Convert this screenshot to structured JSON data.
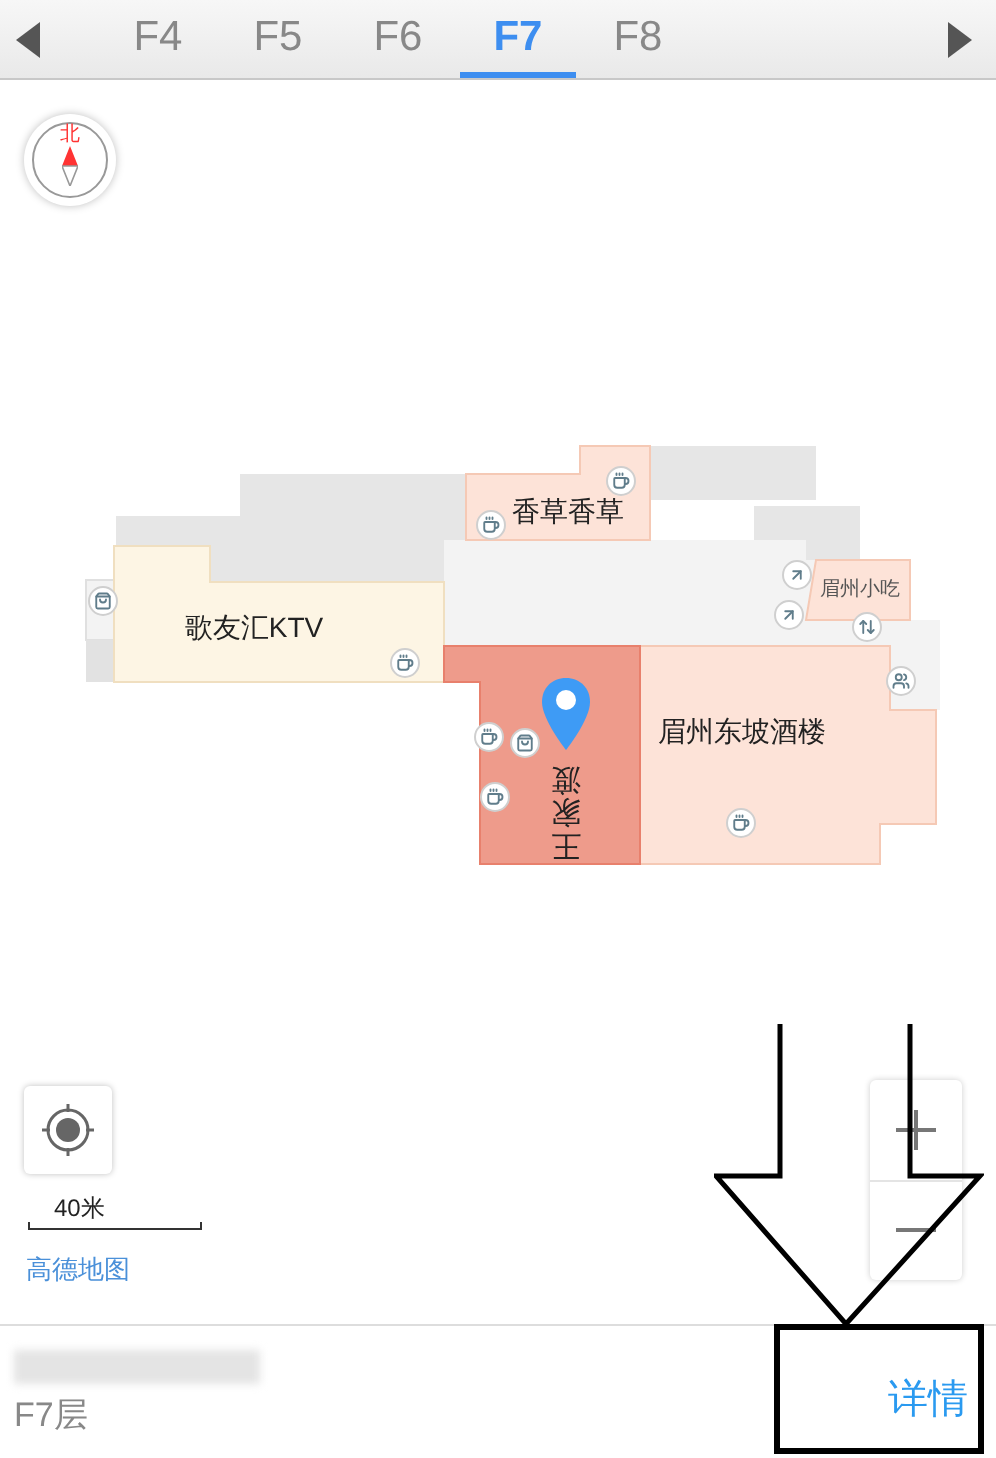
{
  "tabs": [
    {
      "label": "F4",
      "selected": false
    },
    {
      "label": "F5",
      "selected": false
    },
    {
      "label": "F6",
      "selected": false
    },
    {
      "label": "F7",
      "selected": true
    },
    {
      "label": "F8",
      "selected": false
    }
  ],
  "map": {
    "compass_label": "北",
    "shops": [
      {
        "kind": "label",
        "name": "香草香草",
        "selected": false
      },
      {
        "kind": "label",
        "name": "歌友汇KTV",
        "selected": false
      },
      {
        "kind": "small-label",
        "name": "眉州小吃",
        "selected": false
      },
      {
        "kind": "label",
        "name": "眉州东坡酒楼",
        "selected": false
      },
      {
        "kind": "vertical-label",
        "name": "王家渡",
        "selected": true
      }
    ],
    "scale_label": "40米",
    "attribution": "高德地图"
  },
  "place": {
    "floor": "F7层",
    "detail_button": "详情"
  }
}
